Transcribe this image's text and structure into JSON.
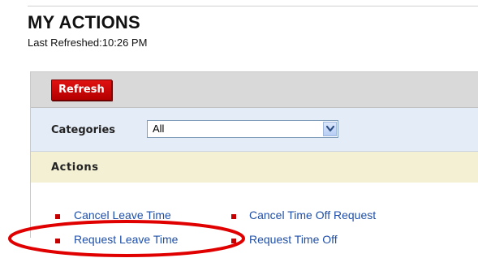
{
  "header": {
    "title": "MY ACTIONS",
    "last_refreshed": "Last Refreshed:10:26 PM"
  },
  "toolbar": {
    "refresh_label": "Refresh"
  },
  "filter": {
    "label": "Categories",
    "selected": "All"
  },
  "actions": {
    "title": "Actions",
    "items": [
      {
        "label": "Cancel Leave Time"
      },
      {
        "label": "Cancel Time Off Request"
      },
      {
        "label": "Request Leave Time"
      },
      {
        "label": "Request Time Off"
      }
    ]
  },
  "colors": {
    "accent_red": "#c40000",
    "link_blue": "#1f4fa8",
    "category_bg": "#e3ecf7",
    "actions_bg": "#f3f0d4",
    "toolbar_bg": "#d9d9d9",
    "annotation_red": "#e00000"
  },
  "icons": {
    "dropdown": "chevron-down-icon",
    "bullet": "square-bullet-icon"
  }
}
